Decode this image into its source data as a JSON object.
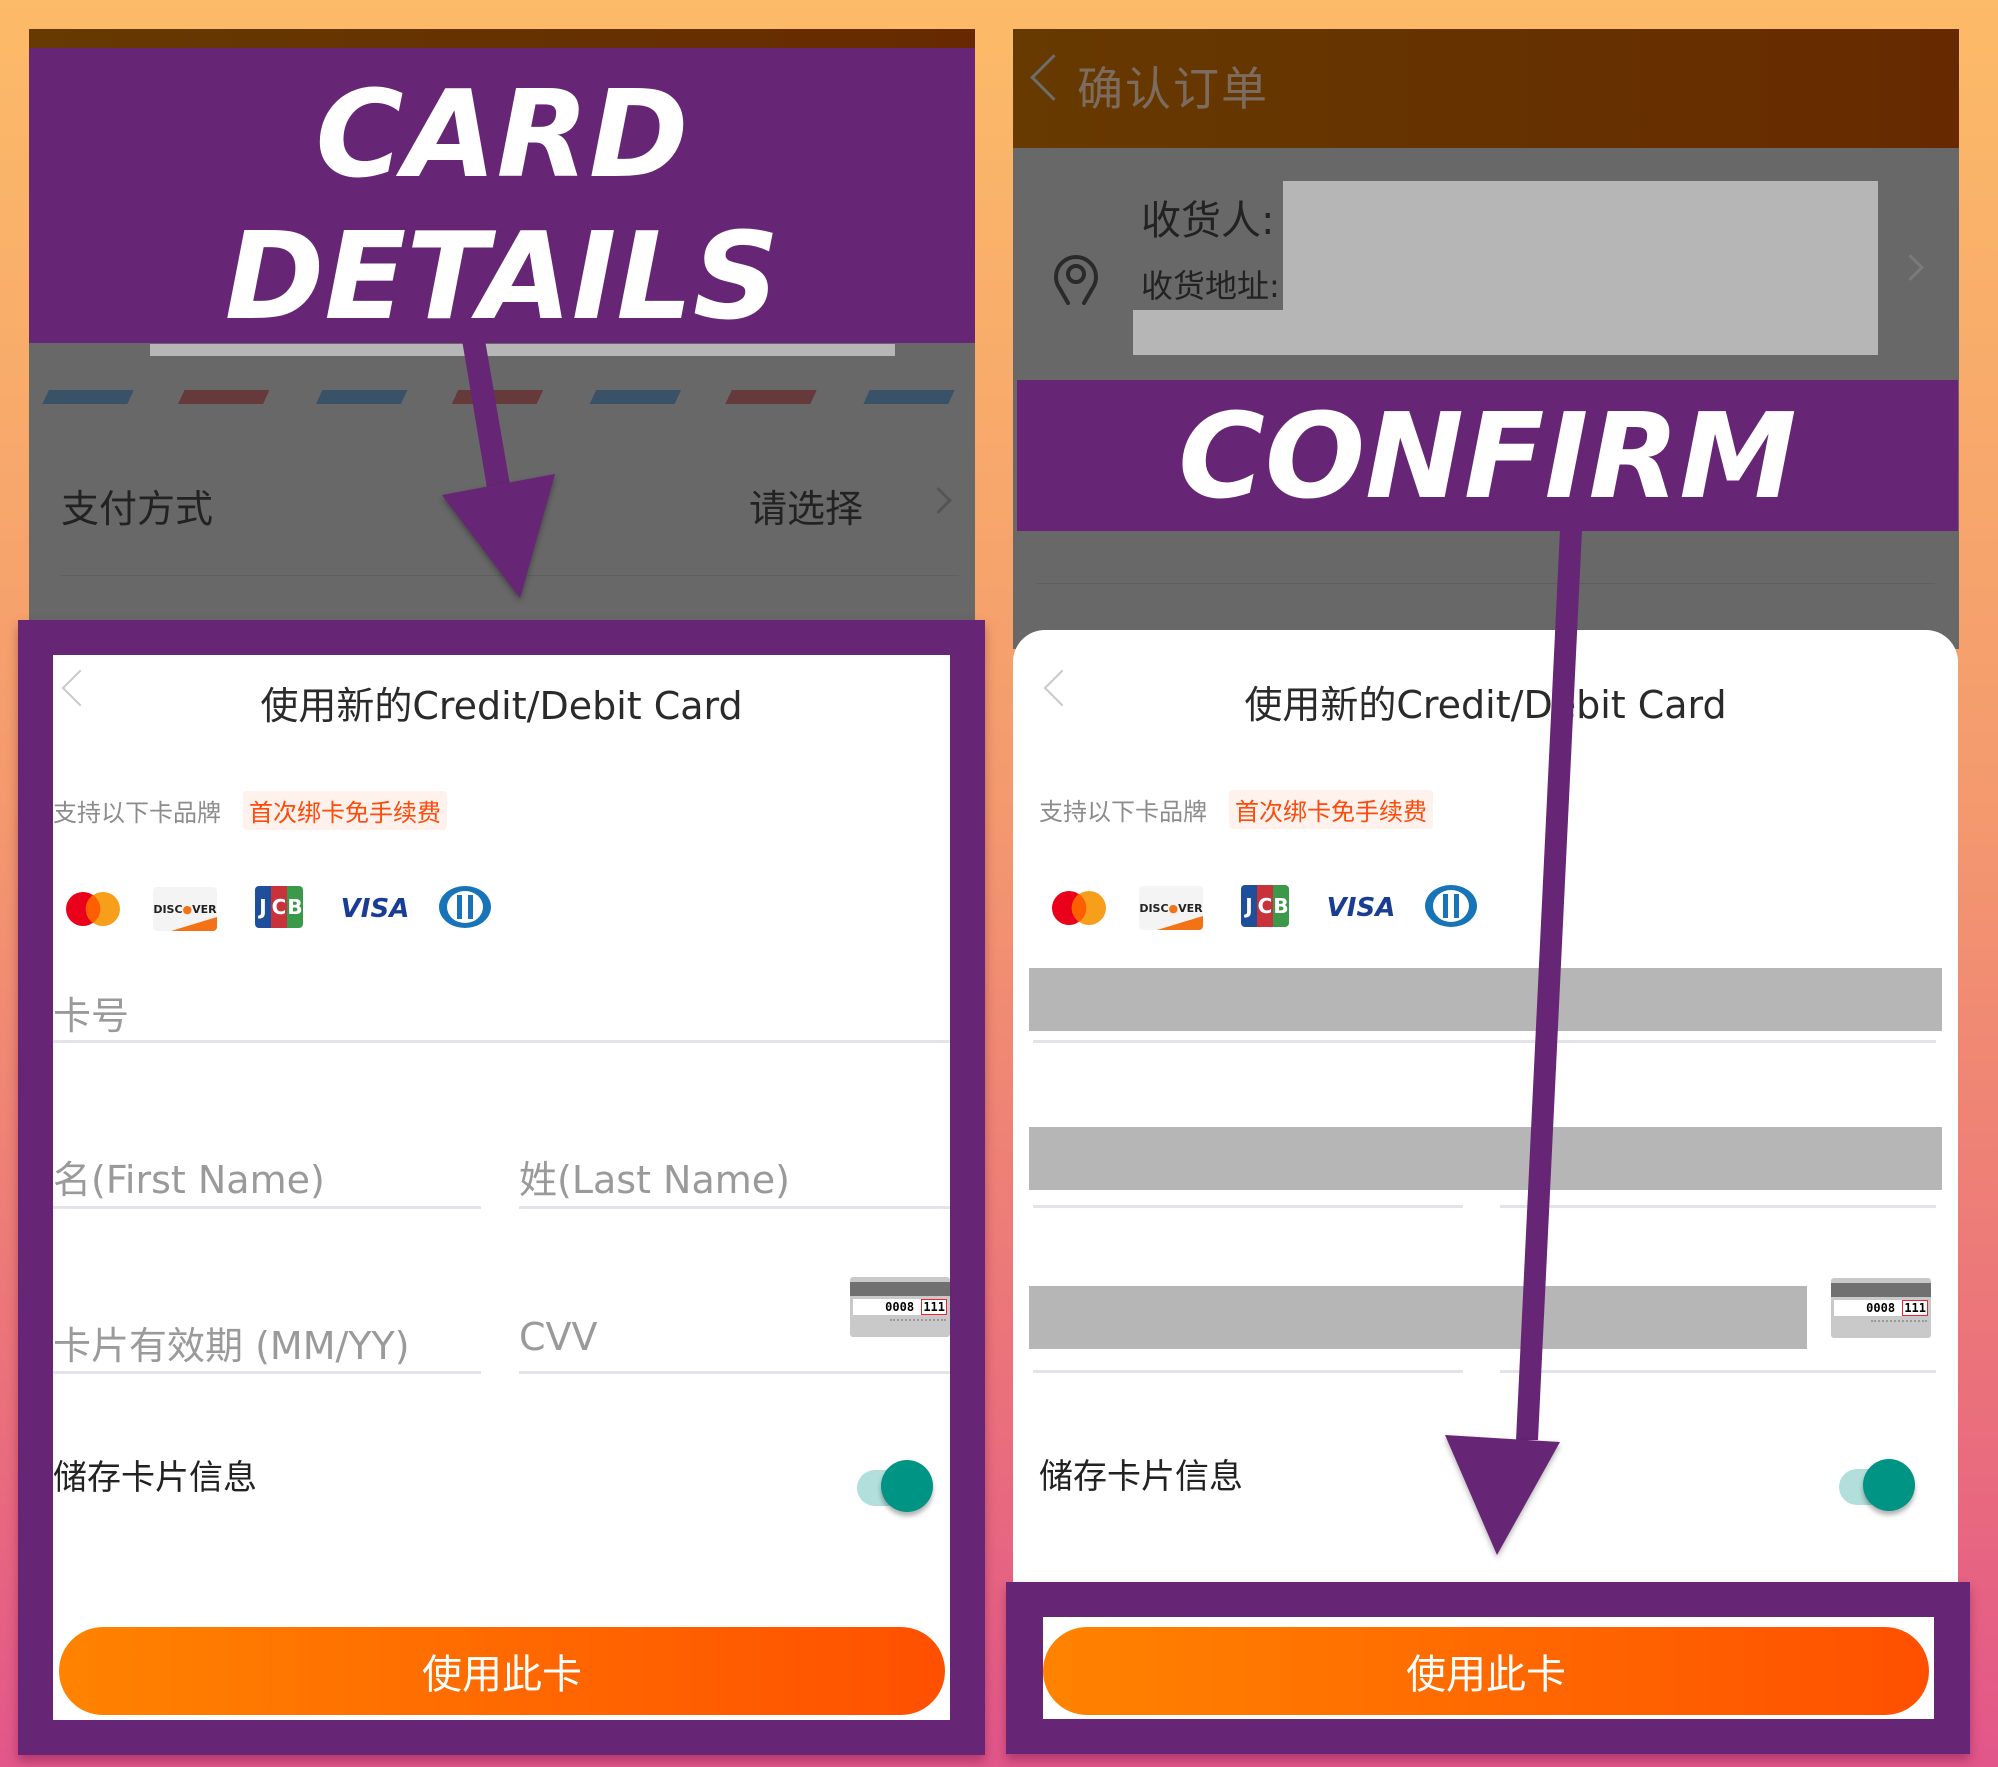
{
  "annotations": {
    "left_banner_line1": "CARD",
    "left_banner_line2": "DETAILS",
    "right_banner": "CONFIRM",
    "color_purple": "#672575"
  },
  "left_screen": {
    "payment_method_label": "支付方式",
    "payment_method_value": "请选择"
  },
  "right_screen": {
    "header_title": "确认订单",
    "recipient_label": "收货人:",
    "address_label": "收货地址:"
  },
  "card_sheet": {
    "title": "使用新的Credit/Debit Card",
    "supported_brands_label": "支持以下卡品牌",
    "promo_badge": "首次绑卡免手续费",
    "brands": [
      "Mastercard",
      "Discover",
      "JCB",
      "VISA",
      "Diners Club"
    ],
    "card_number_placeholder": "卡号",
    "first_name_placeholder": "名(First Name)",
    "last_name_placeholder": "姓(Last Name)",
    "expiry_placeholder": "卡片有效期 (MM/YY)",
    "cvv_placeholder": "CVV",
    "cvv_hint_number": "0008",
    "cvv_hint_code": "111",
    "save_card_label": "储存卡片信息",
    "save_card_enabled": true,
    "use_card_button": "使用此卡",
    "colors": {
      "accent_orange_start": "#ff8300",
      "accent_orange_end": "#ff5000",
      "promo_text": "#ff4a0a",
      "toggle_on": "#009485"
    }
  }
}
